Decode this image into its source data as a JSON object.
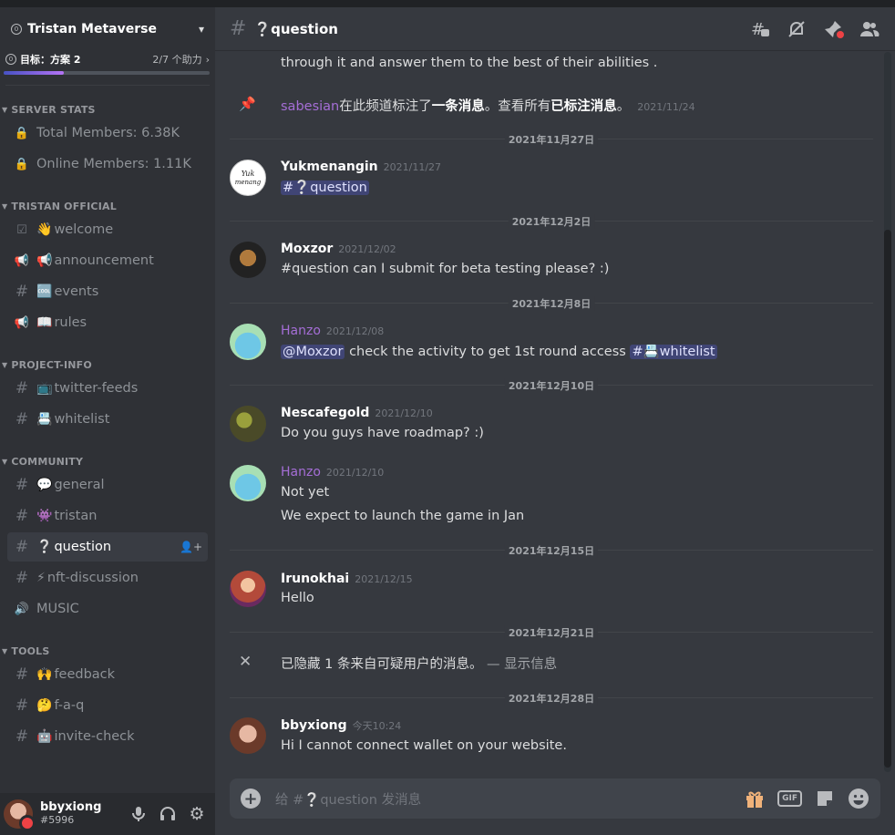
{
  "server": {
    "name": "Tristan Metaverse",
    "badge": "0"
  },
  "boost": {
    "goal": "目标：方案 2",
    "progress": "2/7 个助力",
    "progress_fraction": 0.29
  },
  "categories": [
    {
      "name": "SERVER STATS",
      "channels": [
        {
          "icon": "lock-icon",
          "emoji": "",
          "label": "Total Members: 6.38K"
        },
        {
          "icon": "lock-icon",
          "emoji": "",
          "label": "Online Members: 1.11K"
        }
      ]
    },
    {
      "name": "TRISTAN OFFICIAL",
      "channels": [
        {
          "icon": "rules-icon",
          "emoji": "👋",
          "label": "welcome"
        },
        {
          "icon": "megaphone-icon",
          "emoji": "📢",
          "label": "announcement"
        },
        {
          "icon": "hash-icon",
          "emoji": "🆒",
          "label": "events"
        },
        {
          "icon": "megaphone-icon",
          "emoji": "📖",
          "label": "rules"
        }
      ]
    },
    {
      "name": "PROJECT-INFO",
      "channels": [
        {
          "icon": "hash-icon",
          "emoji": "📺",
          "label": "twitter-feeds"
        },
        {
          "icon": "hash-icon",
          "emoji": "📇",
          "label": "whitelist"
        }
      ]
    },
    {
      "name": "COMMUNITY",
      "channels": [
        {
          "icon": "hash-icon",
          "emoji": "💬",
          "label": "general"
        },
        {
          "icon": "hash-icon",
          "emoji": "👾",
          "label": "tristan"
        },
        {
          "icon": "hash-icon",
          "emoji": "❔",
          "label": "question"
        },
        {
          "icon": "hash-icon",
          "emoji": "⚡",
          "label": "nft-discussion"
        },
        {
          "icon": "speaker-icon",
          "emoji": "",
          "label": "MUSIC"
        }
      ]
    },
    {
      "name": "TOOLS",
      "channels": [
        {
          "icon": "hash-icon",
          "emoji": "🙌",
          "label": "feedback"
        },
        {
          "icon": "hash-icon",
          "emoji": "🤔",
          "label": "f-a-q"
        },
        {
          "icon": "hash-icon",
          "emoji": "🤖",
          "label": "invite-check"
        }
      ]
    }
  ],
  "user": {
    "name": "bbyxiong",
    "tag": "#5996"
  },
  "channel_header": {
    "title": "❔question"
  },
  "messages": {
    "top_line": "through it and answer them to the best of their abilities .",
    "pin": {
      "pinner": "sabesian",
      "text1": "在此频道标注了",
      "bold1": "一条消息",
      "text2": "。查看所有",
      "bold2": "已标注消息",
      "text3": "。",
      "time": "2021/11/24"
    },
    "dates": [
      "2021年11月27日",
      "2021年12月2日",
      "2021年12月8日",
      "2021年12月10日",
      "2021年12月15日",
      "2021年12月21日",
      "2021年12月28日"
    ],
    "m1": {
      "author": "Yukmenangin",
      "time": "2021/11/27",
      "channel_mention": "#❔question"
    },
    "m2": {
      "author": "Moxzor",
      "time": "2021/12/02",
      "text": "#question can I submit for beta testing please? :)"
    },
    "m3": {
      "author": "Hanzo",
      "time": "2021/12/08",
      "user_mention": "@Moxzor",
      "text": " check the activity to get 1st round access ",
      "channel_mention": "#📇whitelist"
    },
    "m4": {
      "author": "Nescafegold",
      "time": "2021/12/10",
      "text": "Do you guys have roadmap? :)"
    },
    "m5": {
      "author": "Hanzo",
      "time": "2021/12/10",
      "text1": "Not yet",
      "text2": "We expect to launch the game in Jan"
    },
    "m6": {
      "author": "Irunokhai",
      "time": "2021/12/15",
      "text": "Hello"
    },
    "hidden": {
      "text": "已隐藏 1 条来自可疑用户的消息。",
      "dash": " — ",
      "link": "显示信息"
    },
    "m7": {
      "author": "bbyxiong",
      "time": "今天10:24",
      "text": "Hi I cannot connect wallet on your website."
    }
  },
  "composer": {
    "placeholder": "给 #❔question 发消息"
  }
}
